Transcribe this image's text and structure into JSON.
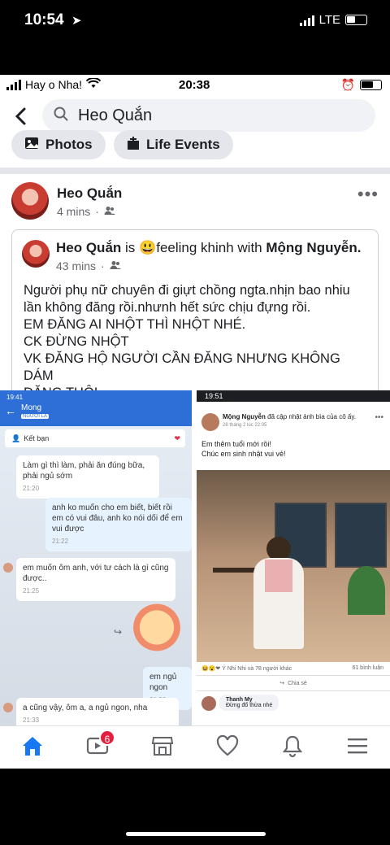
{
  "outer_status": {
    "time": "10:54",
    "network": "LTE"
  },
  "inner_status": {
    "carrier": "Hay o Nha!",
    "time": "20:38"
  },
  "search": {
    "query": "Heo Quắn"
  },
  "chips": {
    "photos": "Photos",
    "life_events": "Life Events"
  },
  "post": {
    "author": "Heo Quắn",
    "time": "4 mins",
    "shared": {
      "author": "Heo Quắn",
      "is": "is",
      "feeling": "feeling khinh with",
      "tagged": "Mộng Nguyễn.",
      "time": "43 mins",
      "text_lines": [
        "Người phụ nữ chuyên đi giựt chồng ngta.nhịn bao nhiu",
        "lần không đăng rồi.nhưnh hết sức chịu đựng rồi.",
        "EM ĐĂNG AI NHỘT THÌ NHỘT NHÉ.",
        "CK ĐỪNG NHỘT",
        "VK ĐĂNG HỘ NGƯỜI CẦN ĐĂNG NHƯNG KHÔNG DÁM",
        "ĐĂNG THÔI"
      ]
    }
  },
  "left_photo": {
    "status_time": "19:41",
    "contact_name": "Mong",
    "contact_sub": "NGƯỜI LẠ",
    "add_friend": "Kết bạn",
    "messages": [
      {
        "text": "Làm gì thì làm, phải ăn đúng bữa, phải ngủ sớm",
        "time": "21:20"
      },
      {
        "text": "anh ko muốn cho em biết, biết rồi em có vui đâu, anh ko nói dối để em vui được",
        "time": "21:22"
      },
      {
        "text": "em muốn ôm anh, với tư cách là gì cũng được..",
        "time": "21:25"
      },
      {
        "text": "em ngủ ngon",
        "time": "21:26"
      },
      {
        "text": "a cũng vậy, ôm a, a ngủ ngon, nha",
        "time": "21:33"
      }
    ]
  },
  "right_photo": {
    "status_time": "19:51",
    "author": "Mộng Nguyễn",
    "action": "đã cập nhật ảnh bìa của cô ấy.",
    "date": "28 tháng 2 lúc 22:05",
    "caption_1": "Em thêm tuổi mới rồi!",
    "caption_2": "Chúc em sinh nhật vui vẻ!",
    "reactions": "Ý Nhi Nhi và 78 người khác",
    "comments_count": "61 bình luận",
    "share": "Chia sẻ",
    "commenter": "Thanh My",
    "comment": "Đừng đổ thừa nhé"
  },
  "tabbar": {
    "video_badge": "6"
  },
  "colors": {
    "accent": "#1877f2",
    "badge": "#e41e3f"
  }
}
